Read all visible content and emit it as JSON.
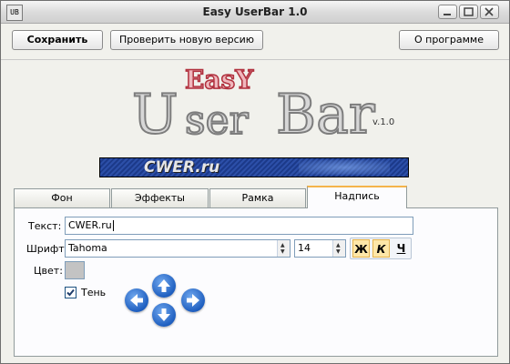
{
  "window": {
    "title": "Easy UserBar 1.0",
    "app_icon": "UB"
  },
  "toolbar": {
    "save_label": "Сохранить",
    "check_version_label": "Проверить новую версию",
    "about_label": "О программе"
  },
  "logo": {
    "easy": "EasY",
    "user": "U",
    "ser": "ser",
    "bar": "Bar",
    "version": "v.1.0"
  },
  "preview": {
    "text": "CWER.ru"
  },
  "tabs": [
    {
      "label": "Фон"
    },
    {
      "label": "Эффекты"
    },
    {
      "label": "Рамка"
    },
    {
      "label": "Надпись"
    }
  ],
  "active_tab": "Надпись",
  "caption": {
    "text_label": "Текст:",
    "text_value": "CWER.ru",
    "font_label": "Шрифт:",
    "font_value": "Tahoma",
    "size_value": "14",
    "bold_label": "Ж",
    "italic_label": "К",
    "underline_label": "Ч",
    "color_label": "Цвет:",
    "color_value": "#c3c3c3",
    "shadow_label": "Тень",
    "shadow_checked": true
  },
  "icons": {
    "minimize": "minimize-icon",
    "maximize": "maximize-icon",
    "close": "close-icon",
    "arrow_up": "arrow-up-icon",
    "arrow_down": "arrow-down-icon",
    "arrow_left": "arrow-left-icon",
    "arrow_right": "arrow-right-icon"
  },
  "colors": {
    "active_tab_accent": "#f4b44a",
    "easy_red": "#b0303d",
    "userbar_blue": "#2c4fa8",
    "arrow_blue": "#1f5fc0"
  }
}
